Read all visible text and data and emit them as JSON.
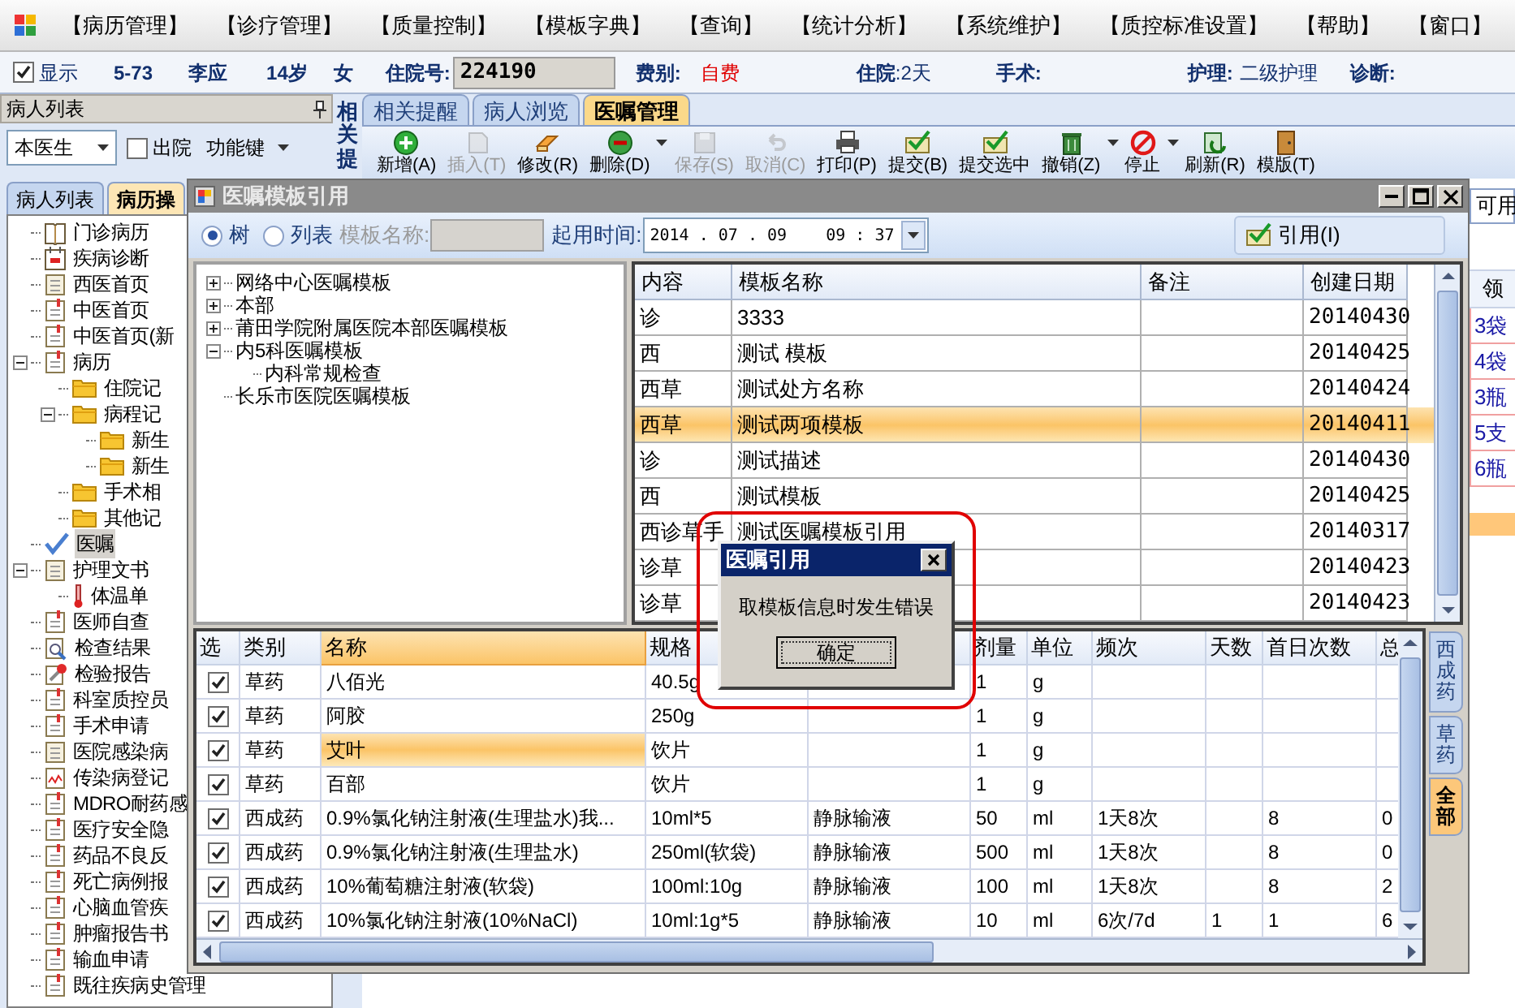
{
  "menu": {
    "items": [
      "【病历管理】",
      "【诊疗管理】",
      "【质量控制】",
      "【模板字典】",
      "【查询】",
      "【统计分析】",
      "【系统维护】",
      "【质控标准设置】",
      "【帮助】",
      "【窗口】"
    ]
  },
  "patient_bar": {
    "show": {
      "label": "显示",
      "checked": true
    },
    "bed": "5-73",
    "name": "李应",
    "age": "14岁",
    "sex": "女",
    "admission_label": "住院号:",
    "admission_no": "224190",
    "fee_label": "费别:",
    "fee": "自费",
    "stay_label": "住院",
    "stay": ":2天",
    "surgery_label": "手术:",
    "nursing_label": "护理:",
    "nursing": "二级护理",
    "diagnosis_label": "诊断:"
  },
  "left_panel": {
    "title": "病人列表",
    "doctor_filter": "本医生",
    "discharged": {
      "label": "出院",
      "checked": false
    },
    "function_key": "功能键",
    "tabs": [
      {
        "label": "病人列表",
        "selected": false
      },
      {
        "label": "病历操",
        "selected": true
      }
    ],
    "tree": [
      {
        "label": "门诊病历",
        "kind": "book",
        "selected": false
      },
      {
        "label": "疾病诊断",
        "kind": "calendar",
        "selected": false
      },
      {
        "label": "西医首页",
        "kind": "page",
        "selected": false
      },
      {
        "label": "中医首页",
        "kind": "doc",
        "selected": false
      },
      {
        "label": "中医首页(新",
        "kind": "doc",
        "selected": false
      },
      {
        "label": "病历",
        "kind": "doc",
        "selected": false,
        "expanded": true,
        "children": [
          {
            "label": "住院记",
            "kind": "folder",
            "selected": false
          },
          {
            "label": "病程记",
            "kind": "folder",
            "selected": false,
            "expanded": true,
            "children": [
              {
                "label": "新生",
                "kind": "folder",
                "selected": false
              },
              {
                "label": "新生",
                "kind": "folder",
                "selected": false
              }
            ]
          },
          {
            "label": "手术相",
            "kind": "folder",
            "selected": false
          },
          {
            "label": "其他记",
            "kind": "folder",
            "selected": false
          }
        ]
      },
      {
        "label": "医嘱",
        "kind": "check",
        "selected": true
      },
      {
        "label": "护理文书",
        "kind": "page",
        "selected": false,
        "expanded": true,
        "children": [
          {
            "label": "体温单",
            "kind": "thermometer",
            "selected": false
          }
        ]
      },
      {
        "label": "医师自查",
        "kind": "doc",
        "selected": false
      },
      {
        "label": "检查结果",
        "kind": "magnifier",
        "selected": false
      },
      {
        "label": "检验报告",
        "kind": "pin",
        "selected": false
      },
      {
        "label": "科室质控员",
        "kind": "doc",
        "selected": false
      },
      {
        "label": "手术申请",
        "kind": "doc",
        "selected": false
      },
      {
        "label": "医院感染病",
        "kind": "page",
        "selected": false
      },
      {
        "label": "传染病登记",
        "kind": "chart",
        "selected": false
      },
      {
        "label": "MDRO耐药感",
        "kind": "doc",
        "selected": false
      },
      {
        "label": "医疗安全隐",
        "kind": "doc",
        "selected": false
      },
      {
        "label": "药品不良反",
        "kind": "doc",
        "selected": false
      },
      {
        "label": "死亡病例报",
        "kind": "doc",
        "selected": false
      },
      {
        "label": "心脑血管疾",
        "kind": "doc",
        "selected": false
      },
      {
        "label": "肿瘤报告书",
        "kind": "doc",
        "selected": false
      },
      {
        "label": "输血申请",
        "kind": "doc",
        "selected": false
      },
      {
        "label": "既往疾病史管理",
        "kind": "doc",
        "selected": false
      }
    ]
  },
  "side_label": "相关提",
  "tabs": [
    {
      "label": "相关提醒",
      "selected": false
    },
    {
      "label": "病人浏览",
      "selected": false
    },
    {
      "label": "医嘱管理",
      "selected": true
    }
  ],
  "toolbar": [
    {
      "label": "新增(A)",
      "kind": "plus",
      "disabled": false,
      "dropdown": false
    },
    {
      "label": "插入(T)",
      "kind": "page",
      "disabled": true,
      "dropdown": false
    },
    {
      "label": "修改(R)",
      "kind": "eraser",
      "disabled": false,
      "dropdown": false
    },
    {
      "label": "删除(D)",
      "kind": "minus",
      "disabled": false,
      "dropdown": true
    },
    {
      "label": "保存(S)",
      "kind": "disk",
      "disabled": true,
      "dropdown": false
    },
    {
      "label": "取消(C)",
      "kind": "undo",
      "disabled": true,
      "dropdown": false
    },
    {
      "label": "打印(P)",
      "kind": "printer",
      "disabled": false,
      "dropdown": false
    },
    {
      "label": "提交(B)",
      "kind": "check",
      "disabled": false,
      "dropdown": false
    },
    {
      "label": "提交选中",
      "kind": "check",
      "disabled": false,
      "dropdown": false
    },
    {
      "label": "撤销(Z)",
      "kind": "trash",
      "disabled": false,
      "dropdown": true
    },
    {
      "label": "停止",
      "kind": "stop",
      "disabled": false,
      "dropdown": true
    },
    {
      "label": "刷新(R)",
      "kind": "refresh",
      "disabled": false,
      "dropdown": false
    },
    {
      "label": "模版(T)",
      "kind": "door",
      "disabled": false,
      "dropdown": false
    }
  ],
  "right_strip": {
    "tab": "可用",
    "column_header": "领",
    "quantities": [
      "3袋",
      "4袋",
      "3瓶",
      "5支",
      "6瓶"
    ]
  },
  "dialog": {
    "title": "医嘱模板引用",
    "radios": [
      {
        "label": "树",
        "selected": true
      },
      {
        "label": "列表",
        "selected": false
      }
    ],
    "name_label": "模板名称:",
    "start_label": "起用时间:",
    "start_value": "2014 . 07 . 09    09 : 37",
    "cite_button": "引用(I)",
    "template_tree": [
      {
        "label": "网络中心医嘱模板",
        "expanded": false
      },
      {
        "label": "本部",
        "expanded": false
      },
      {
        "label": "莆田学院附属医院本部医嘱模板",
        "expanded": false
      },
      {
        "label": "内5科医嘱模板",
        "expanded": true,
        "children": [
          {
            "label": "内科常规检查"
          }
        ]
      },
      {
        "label": "长乐市医院医嘱模板"
      }
    ],
    "template_table": {
      "columns": [
        "内容",
        "模板名称",
        "备注",
        "创建日期"
      ],
      "rows": [
        {
          "content": "诊",
          "name": "3333",
          "date": "20140430",
          "selected": false
        },
        {
          "content": "西",
          "name": "测试 模板",
          "date": "20140425",
          "selected": false
        },
        {
          "content": "西草",
          "name": "测试处方名称",
          "date": "20140424",
          "selected": false
        },
        {
          "content": "西草",
          "name": "测试两项模板",
          "date": "20140411",
          "selected": true
        },
        {
          "content": "诊",
          "name": "测试描述",
          "date": "20140430",
          "selected": false
        },
        {
          "content": "西",
          "name": "测试模板",
          "date": "20140425",
          "selected": false
        },
        {
          "content": "西诊草手",
          "name": "测试医嘱模板引用",
          "date": "20140317",
          "selected": false
        },
        {
          "content": "诊草",
          "date": "20140423",
          "selected": false
        },
        {
          "content": "诊草",
          "date": "20140423",
          "selected": false
        }
      ]
    },
    "items_table": {
      "columns": [
        "选",
        "类别",
        "名称",
        "规格",
        "",
        "剂量",
        "单位",
        "频次",
        "天数",
        "首日次数",
        "总"
      ],
      "rows": [
        {
          "checked": true,
          "selected": false,
          "cells": [
            "",
            "草药",
            "八佰光",
            "40.5g",
            "",
            "1",
            "g",
            "",
            "",
            "",
            ""
          ]
        },
        {
          "checked": true,
          "selected": false,
          "cells": [
            "",
            "草药",
            "阿胶",
            "250g",
            "",
            "1",
            "g",
            "",
            "",
            "",
            ""
          ]
        },
        {
          "checked": true,
          "selected": true,
          "cells": [
            "",
            "草药",
            "艾叶",
            "饮片",
            "",
            "1",
            "g",
            "",
            "",
            "",
            ""
          ]
        },
        {
          "checked": true,
          "selected": false,
          "cells": [
            "",
            "草药",
            "百部",
            "饮片",
            "",
            "1",
            "g",
            "",
            "",
            "",
            ""
          ]
        },
        {
          "checked": true,
          "selected": false,
          "cells": [
            "",
            "西成药",
            "0.9%氯化钠注射液(生理盐水)我...",
            "10ml*5",
            "静脉输液",
            "50",
            "ml",
            "1天8次",
            "",
            "8",
            "0"
          ]
        },
        {
          "checked": true,
          "selected": false,
          "cells": [
            "",
            "西成药",
            "0.9%氯化钠注射液(生理盐水)",
            "250ml(软袋)",
            "静脉输液",
            "500",
            "ml",
            "1天8次",
            "",
            "8",
            "0"
          ]
        },
        {
          "checked": true,
          "selected": false,
          "cells": [
            "",
            "西成药",
            "10%葡萄糖注射液(软袋)",
            "100ml:10g",
            "静脉输液",
            "100",
            "ml",
            "1天8次",
            "",
            "8",
            "2"
          ]
        },
        {
          "checked": true,
          "selected": false,
          "cells": [
            "",
            "西成药",
            "10%氯化钠注射液(10%NaCl)",
            "10ml:1g*5",
            "静脉输液",
            "10",
            "ml",
            "6次/7d",
            "1",
            "1",
            "6"
          ]
        }
      ]
    },
    "category_tabs": [
      {
        "label": "西成药",
        "selected": false
      },
      {
        "label": "草药",
        "selected": false
      },
      {
        "label": "全部",
        "selected": true
      }
    ],
    "message_box": {
      "title": "医嘱引用",
      "message": "取模板信息时发生错误",
      "button": "确定"
    }
  }
}
